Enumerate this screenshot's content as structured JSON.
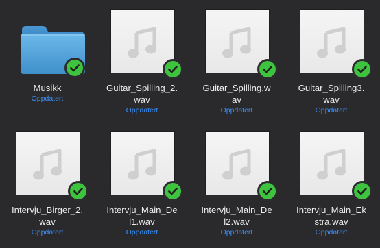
{
  "colors": {
    "background": "#2a2a2c",
    "status_text": "#3a8ef6",
    "badge_green": "#3ec33f",
    "folder_blue": "#5aa9e0"
  },
  "items": [
    {
      "name": "Musikk",
      "status": "Oppdatert",
      "kind": "folder",
      "icon": "folder-icon",
      "badge": "synced-check-icon"
    },
    {
      "name": "Guitar_Spilling_2.wav",
      "line1": "Guitar_Spilling_2.",
      "line2": "wav",
      "status": "Oppdatert",
      "kind": "audio",
      "icon": "music-note-icon",
      "badge": "synced-check-icon"
    },
    {
      "name": "Guitar_Spilling.wav",
      "line1": "Guitar_Spilling.w",
      "line2": "av",
      "status": "Oppdatert",
      "kind": "audio",
      "icon": "music-note-icon",
      "badge": "synced-check-icon"
    },
    {
      "name": "Guitar_Spilling3.wav",
      "line1": "Guitar_Spilling3.",
      "line2": "wav",
      "status": "Oppdatert",
      "kind": "audio",
      "icon": "music-note-icon",
      "badge": "synced-check-icon"
    },
    {
      "name": "Intervju_Birger_2.wav",
      "line1": "Intervju_Birger_2.",
      "line2": "wav",
      "status": "Oppdatert",
      "kind": "audio",
      "icon": "music-note-icon",
      "badge": "synced-check-icon"
    },
    {
      "name": "Intervju_Main_Del1.wav",
      "line1": "Intervju_Main_De",
      "line2": "l1.wav",
      "status": "Oppdatert",
      "kind": "audio",
      "icon": "music-note-icon",
      "badge": "synced-check-icon"
    },
    {
      "name": "Intervju_Main_Del2.wav",
      "line1": "Intervju_Main_De",
      "line2": "l2.wav",
      "status": "Oppdatert",
      "kind": "audio",
      "icon": "music-note-icon",
      "badge": "synced-check-icon"
    },
    {
      "name": "Intervju_Main_Ekstra.wav",
      "line1": "Intervju_Main_Ek",
      "line2": "stra.wav",
      "status": "Oppdatert",
      "kind": "audio",
      "icon": "music-note-icon",
      "badge": "synced-check-icon"
    }
  ]
}
